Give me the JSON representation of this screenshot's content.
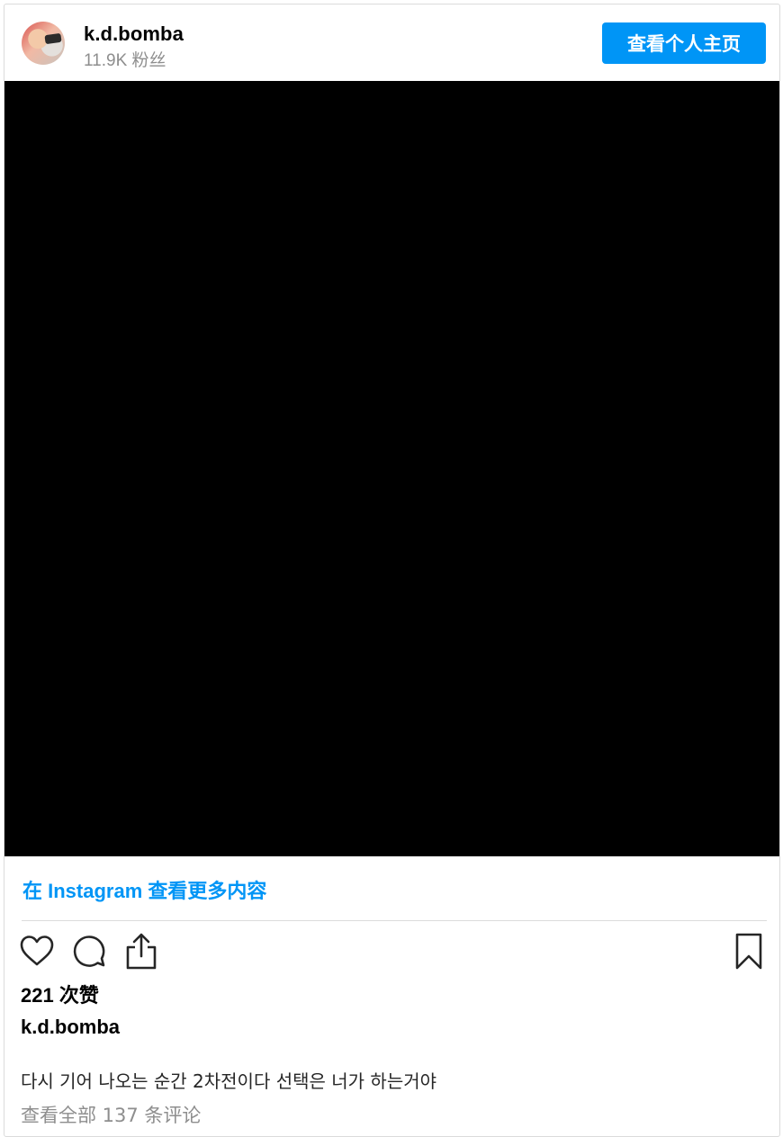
{
  "header": {
    "username": "k.d.bomba",
    "followers": "11.9K 粉丝",
    "profile_button": "查看个人主页"
  },
  "view_more_link": "在 Instagram 查看更多内容",
  "stats": {
    "likes": "221 次赞"
  },
  "caption": {
    "username": "k.d.bomba",
    "text": "다시 기어 나오는 순간 2차전이다 선택은 너가 하는거야"
  },
  "comments_link": "查看全部 137 条评论",
  "icons": {
    "like": "heart-icon",
    "comment": "comment-icon",
    "share": "share-icon",
    "save": "bookmark-icon"
  },
  "colors": {
    "accent": "#0095f6",
    "secondary_text": "#8e8e8e",
    "border": "#dbdbdb",
    "media_background": "#000000"
  }
}
